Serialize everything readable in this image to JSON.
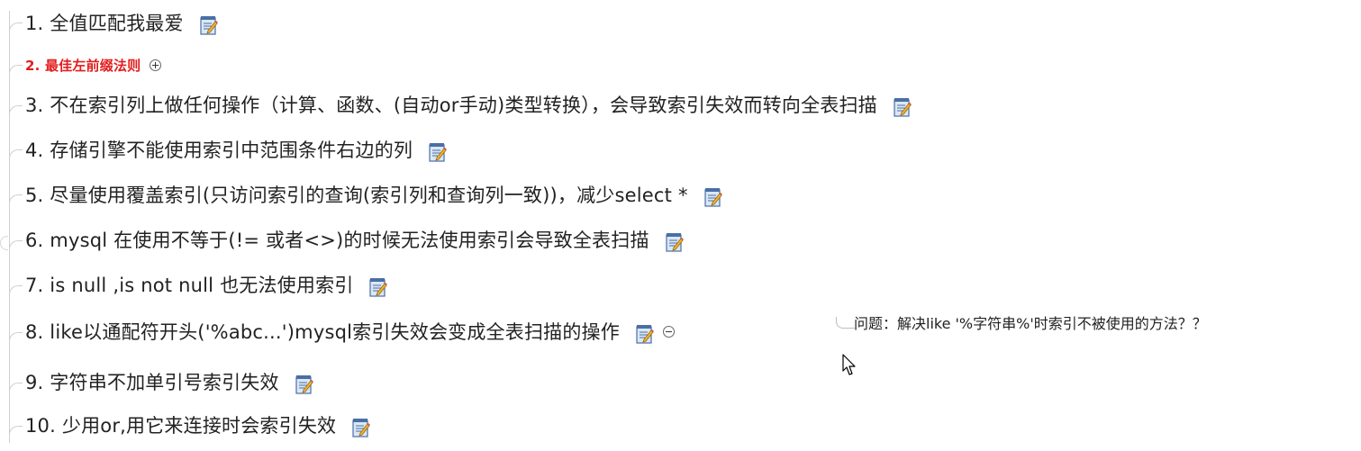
{
  "items": [
    {
      "label": "1. 全值匹配我最爱"
    },
    {
      "label": "2. 最佳左前缀法则"
    },
    {
      "label": "3. 不在索引列上做任何操作（计算、函数、(自动or手动)类型转换），会导致索引失效而转向全表扫描"
    },
    {
      "label": "4. 存储引擎不能使用索引中范围条件右边的列"
    },
    {
      "label": "5. 尽量使用覆盖索引(只访问索引的查询(索引列和查询列一致))，减少select *"
    },
    {
      "label": "6. mysql 在使用不等于(!= 或者<>)的时候无法使用索引会导致全表扫描"
    },
    {
      "label": "7. is null ,is not null 也无法使用索引"
    },
    {
      "label": "8. like以通配符开头('%abc...')mysql索引失效会变成全表扫描的操作"
    },
    {
      "label": "9. 字符串不加单引号索引失效"
    },
    {
      "label": "10. 少用or,用它来连接时会索引失效"
    }
  ],
  "child_note": {
    "label": "问题：解决like '%字符串%'时索引不被使用的方法？？"
  },
  "icons": {
    "note": "note-edit-icon",
    "expand": "expand-plus-icon",
    "collapse": "collapse-minus-icon",
    "cursor": "mouse-pointer-icon"
  },
  "colors": {
    "highlight": "#e31d1d"
  }
}
